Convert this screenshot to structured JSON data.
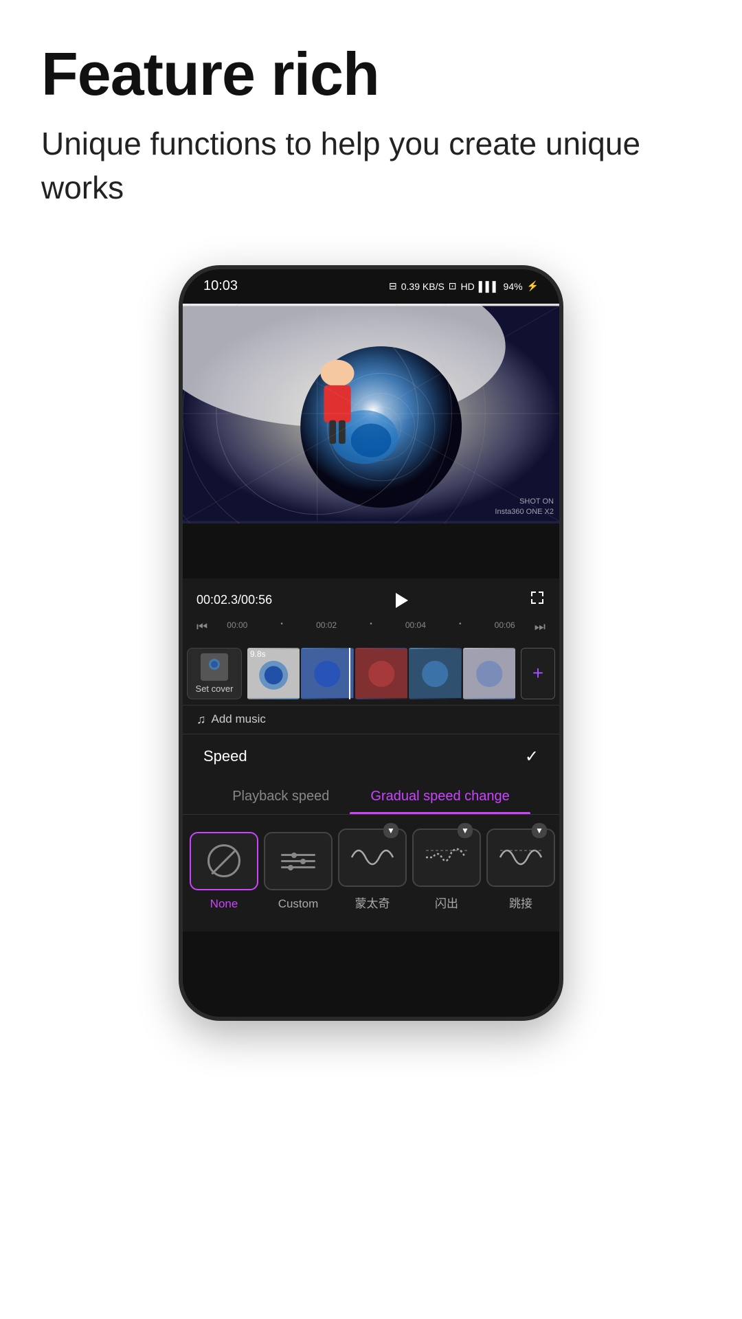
{
  "page": {
    "title": "Feature rich",
    "subtitle": "Unique functions to help you create unique works"
  },
  "phone": {
    "status": {
      "time": "10:03",
      "battery_info": "0.39 KB/S",
      "battery_pct": "94%"
    },
    "video": {
      "shot_on": "SHOT ON\nInsta360 ONE X2"
    },
    "player": {
      "current_time": "00:02.3/00:56",
      "timeline_marks": [
        "00:00",
        "00:02",
        "00:04",
        "00:06"
      ],
      "clip_duration": "9.8s"
    },
    "add_music": {
      "label": "Add music"
    },
    "speed_panel": {
      "title": "Speed",
      "tabs": [
        {
          "id": "playback",
          "label": "Playback speed",
          "active": false
        },
        {
          "id": "gradual",
          "label": "Gradual speed change",
          "active": true
        }
      ],
      "options": [
        {
          "id": "none",
          "label": "None",
          "selected": true,
          "icon": "none"
        },
        {
          "id": "custom",
          "label": "Custom",
          "selected": false,
          "icon": "sliders"
        },
        {
          "id": "montage",
          "label": "蒙太奇",
          "selected": false,
          "icon": "wave1"
        },
        {
          "id": "flash",
          "label": "闪出",
          "selected": false,
          "icon": "wave2"
        },
        {
          "id": "jump",
          "label": "跳接",
          "selected": false,
          "icon": "wave3"
        }
      ]
    }
  }
}
